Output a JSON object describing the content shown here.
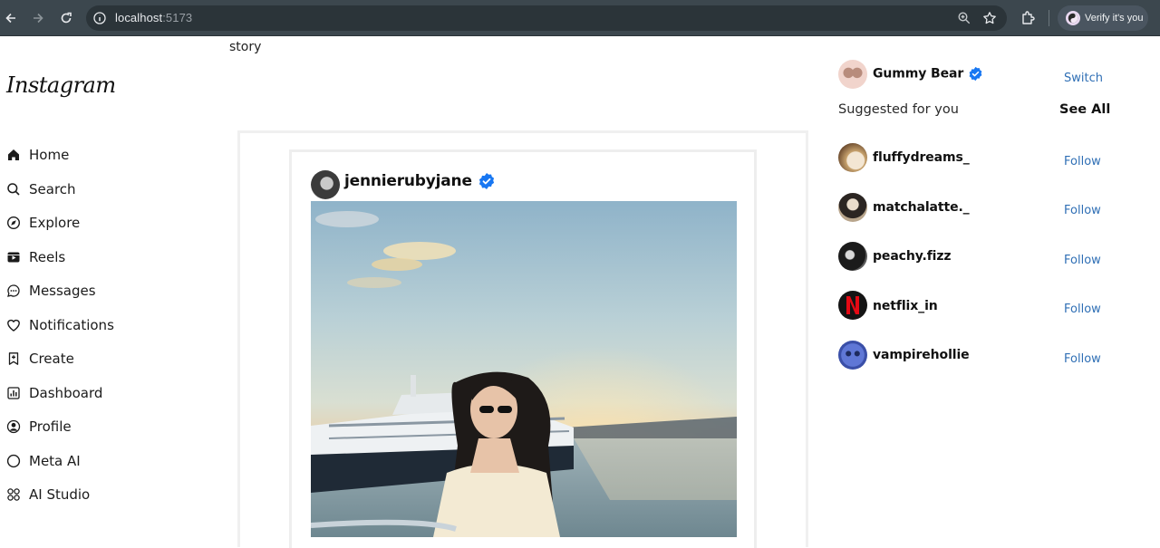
{
  "browser": {
    "url_host": "localhost",
    "url_port": ":5173",
    "profile_label": "Verify it's you"
  },
  "logo": "Instagram",
  "nav": {
    "items": [
      {
        "label": "Home",
        "icon": "home-icon"
      },
      {
        "label": "Search",
        "icon": "search-icon"
      },
      {
        "label": "Explore",
        "icon": "compass-icon"
      },
      {
        "label": "Reels",
        "icon": "reels-icon"
      },
      {
        "label": "Messages",
        "icon": "message-icon"
      },
      {
        "label": "Notifications",
        "icon": "heart-icon"
      },
      {
        "label": "Create",
        "icon": "create-icon"
      },
      {
        "label": "Dashboard",
        "icon": "dashboard-icon"
      },
      {
        "label": "Profile",
        "icon": "profile-icon"
      },
      {
        "label": "Meta AI",
        "icon": "meta-ai-icon"
      },
      {
        "label": "AI Studio",
        "icon": "ai-studio-icon"
      }
    ]
  },
  "main": {
    "story_label": "story",
    "post": {
      "username": "jennierubyjane",
      "verified": true
    }
  },
  "sidebar": {
    "current_user": {
      "name": "Gummy Bear",
      "verified": true,
      "action": "Switch"
    },
    "suggested_title": "Suggested for you",
    "see_all": "See All",
    "suggestions": [
      {
        "name": "fluffydreams_",
        "action": "Follow"
      },
      {
        "name": "matchalatte._",
        "action": "Follow"
      },
      {
        "name": "peachy.fizz",
        "action": "Follow"
      },
      {
        "name": "netflix_in",
        "action": "Follow"
      },
      {
        "name": "vampirehollie",
        "action": "Follow"
      }
    ]
  },
  "colors": {
    "chrome_bg": "#3c474e",
    "omnibox_bg": "#2b3439",
    "verified_blue": "#1877f2",
    "follow_blue": "#2f6fb5"
  }
}
